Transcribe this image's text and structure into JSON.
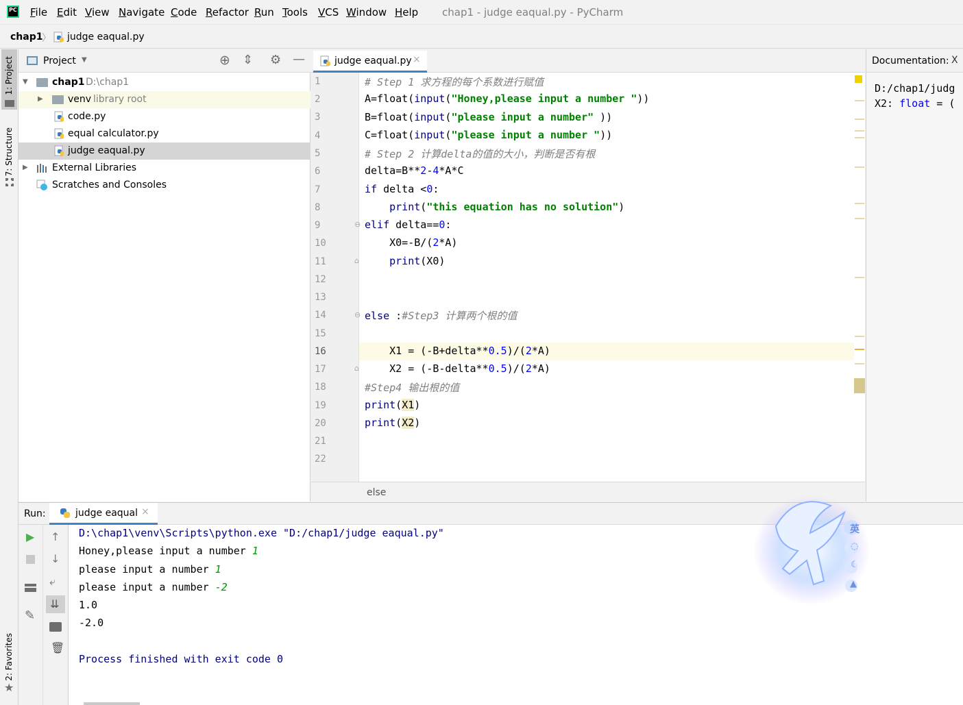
{
  "menubar": {
    "items": [
      "File",
      "Edit",
      "View",
      "Navigate",
      "Code",
      "Refactor",
      "Run",
      "Tools",
      "VCS",
      "Window",
      "Help"
    ],
    "window_title": "chap1 - judge eaqual.py - PyCharm"
  },
  "breadcrumb": {
    "project": "chap1",
    "file": "judge eaqual.py"
  },
  "left_strip": {
    "project_tab": "1: Project",
    "structure_tab": "7: Structure",
    "favorites_tab": "2: Favorites"
  },
  "project_panel": {
    "title": "Project",
    "tree": [
      {
        "name": "chap1",
        "path": "D:\\chap1"
      },
      {
        "name": "venv",
        "note": "library root"
      },
      {
        "name": "code.py"
      },
      {
        "name": "equal calculator.py"
      },
      {
        "name": "judge eaqual.py"
      },
      {
        "name": "External Libraries"
      },
      {
        "name": "Scratches and Consoles"
      }
    ]
  },
  "editor": {
    "tab_label": "judge eaqual.py",
    "current_line": 16,
    "status_context": "else",
    "line_numbers": [
      "1",
      "2",
      "3",
      "4",
      "5",
      "6",
      "7",
      "8",
      "9",
      "10",
      "11",
      "12",
      "13",
      "14",
      "15",
      "16",
      "17",
      "18",
      "19",
      "20",
      "21",
      "22"
    ]
  },
  "documentation": {
    "title": "Documentation:",
    "line1": "D:/chap1/judg",
    "line2_prefix": "X2: ",
    "line2_type": "float",
    "line2_suffix": " = ("
  },
  "run": {
    "label": "Run:",
    "tab_label": "judge eaqual",
    "console": {
      "command": "D:\\chap1\\venv\\Scripts\\python.exe \"D:/chap1/judge eaqual.py\"",
      "prompts": [
        {
          "text": "Honey,please input a number ",
          "input": "1"
        },
        {
          "text": "please input a number ",
          "input": "1"
        },
        {
          "text": "please input a number ",
          "input": "-2"
        }
      ],
      "outputs": [
        "1.0",
        "-2.0"
      ],
      "finish": "Process finished with exit code 0"
    }
  },
  "ime_overlay": {
    "lang_char": "英"
  }
}
